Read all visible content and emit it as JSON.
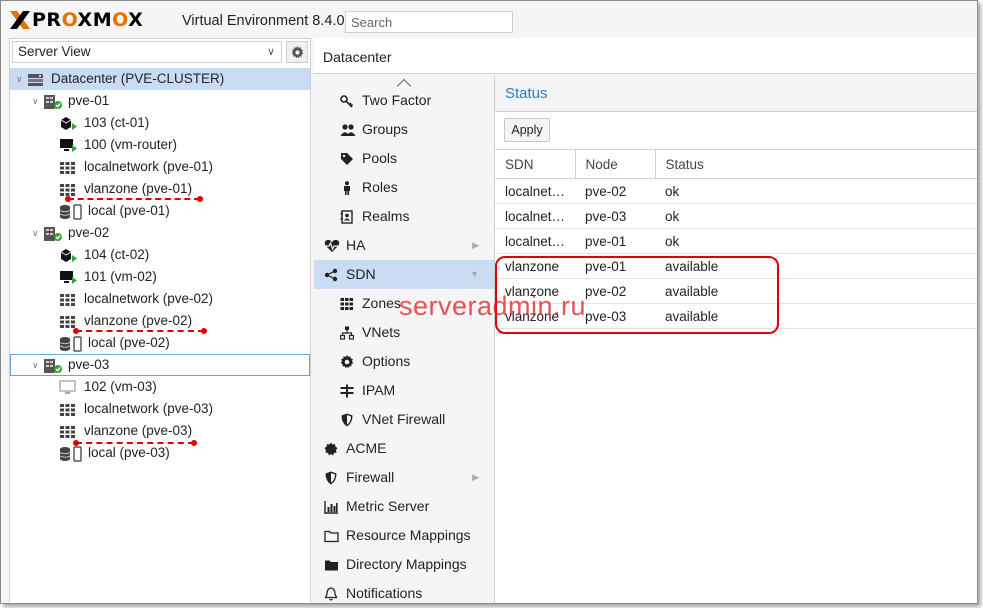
{
  "header": {
    "logo_text": "PROXMOX",
    "product": "Virtual Environment 8.4.0",
    "search_placeholder": "Search"
  },
  "left_panel": {
    "view_selector": "Server View",
    "tree": {
      "datacenter": "Datacenter (PVE-CLUSTER)",
      "nodes": [
        {
          "name": "pve-01",
          "children": [
            {
              "label": "103 (ct-01)",
              "icon": "container-running-icon"
            },
            {
              "label": "100 (vm-router)",
              "icon": "vm-running-icon"
            },
            {
              "label": "localnetwork (pve-01)",
              "icon": "sdn-zone-icon"
            },
            {
              "label": "vlanzone (pve-01)",
              "icon": "sdn-zone-icon"
            },
            {
              "label": "local (pve-01)",
              "icon": "storage-icon"
            }
          ]
        },
        {
          "name": "pve-02",
          "children": [
            {
              "label": "104 (ct-02)",
              "icon": "container-running-icon"
            },
            {
              "label": "101 (vm-02)",
              "icon": "vm-running-icon"
            },
            {
              "label": "localnetwork (pve-02)",
              "icon": "sdn-zone-icon"
            },
            {
              "label": "vlanzone (pve-02)",
              "icon": "sdn-zone-icon"
            },
            {
              "label": "local (pve-02)",
              "icon": "storage-icon"
            }
          ]
        },
        {
          "name": "pve-03",
          "children": [
            {
              "label": "102 (vm-03)",
              "icon": "vm-stopped-icon"
            },
            {
              "label": "localnetwork (pve-03)",
              "icon": "sdn-zone-icon"
            },
            {
              "label": "vlanzone (pve-03)",
              "icon": "sdn-zone-icon"
            },
            {
              "label": "local (pve-03)",
              "icon": "storage-icon"
            }
          ]
        }
      ]
    }
  },
  "content": {
    "breadcrumb": "Datacenter",
    "nav": [
      {
        "label": "Two Factor",
        "icon": "key-icon",
        "indent": true
      },
      {
        "label": "Groups",
        "icon": "users-icon",
        "indent": true
      },
      {
        "label": "Pools",
        "icon": "tags-icon",
        "indent": true
      },
      {
        "label": "Roles",
        "icon": "male-icon",
        "indent": true
      },
      {
        "label": "Realms",
        "icon": "address-book-icon",
        "indent": true
      },
      {
        "label": "HA",
        "icon": "heartbeat-icon",
        "indent": false,
        "arrow": true
      },
      {
        "label": "SDN",
        "icon": "sdn-icon",
        "indent": false,
        "arrow": true,
        "active": true
      },
      {
        "label": "Zones",
        "icon": "th-icon",
        "indent": true
      },
      {
        "label": "VNets",
        "icon": "sitemap-icon",
        "indent": true
      },
      {
        "label": "Options",
        "icon": "gear-icon",
        "indent": true
      },
      {
        "label": "IPAM",
        "icon": "ipam-icon",
        "indent": true
      },
      {
        "label": "VNet Firewall",
        "icon": "shield-icon",
        "indent": true
      },
      {
        "label": "ACME",
        "icon": "certificate-icon",
        "indent": false
      },
      {
        "label": "Firewall",
        "icon": "shield-icon",
        "indent": false,
        "arrow": true
      },
      {
        "label": "Metric Server",
        "icon": "bar-chart-icon",
        "indent": false
      },
      {
        "label": "Resource Mappings",
        "icon": "folder-outline-icon",
        "indent": false
      },
      {
        "label": "Directory Mappings",
        "icon": "folder-icon",
        "indent": false
      },
      {
        "label": "Notifications",
        "icon": "bell-icon",
        "indent": false
      }
    ],
    "status": {
      "title": "Status",
      "apply_label": "Apply",
      "columns": [
        "SDN",
        "Node",
        "Status"
      ],
      "rows": [
        [
          "localnet…",
          "pve-02",
          "ok"
        ],
        [
          "localnet…",
          "pve-03",
          "ok"
        ],
        [
          "localnet…",
          "pve-01",
          "ok"
        ],
        [
          "vlanzone",
          "pve-01",
          "available"
        ],
        [
          "vlanzone",
          "pve-02",
          "available"
        ],
        [
          "vlanzone",
          "pve-03",
          "available"
        ]
      ]
    }
  },
  "watermark": "serveradmin.ru",
  "colors": {
    "accent": "#2a7ac0",
    "selection": "#c9dcf3",
    "logo_orange": "#e57000",
    "annotation_red": "#e00000",
    "running_green": "#2fa630"
  }
}
